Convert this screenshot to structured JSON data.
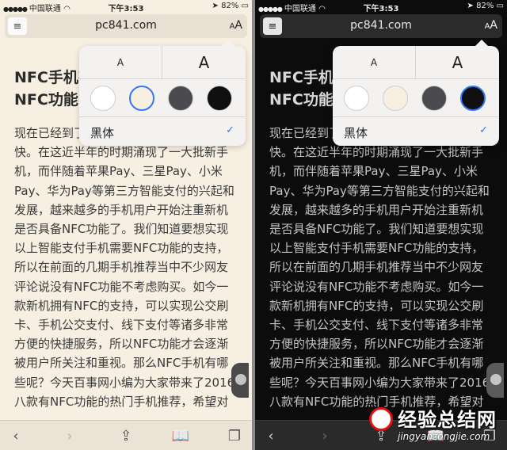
{
  "status": {
    "carrier": "中国联通",
    "time": "下午3:53",
    "battery": "82%"
  },
  "addressbar": {
    "url": "pc841.com",
    "aa_small": "A",
    "aa_large": "A"
  },
  "article": {
    "title_lines": [
      "NFC手机有哪些",
      "NFC功能的热门手机"
    ],
    "paragraph_lines": [
      "现在已经到了双十一的时候，时间过得真",
      "快。在这近半年的时期涌现了一大批新手",
      "机，而伴随着苹果Pay、三星Pay、小米",
      "Pay、华为Pay等第三方智能支付的兴起和",
      "发展，越来越多的手机用户开始注重新机",
      "是否具备NFC功能了。我们知道要想实现",
      "以上智能支付手机需要NFC功能的支持，",
      "所以在前面的几期手机推荐当中不少网友",
      "评论说没有NFC功能不考虑购买。如今一",
      "款新机拥有NFC的支持，可以实现公交刷",
      "卡、手机公交支付、线下支付等诸多非常",
      "方便的快捷服务，所以NFC功能才会逐渐",
      "被用户所关注和重视。那么NFC手机有哪",
      "些呢？今天百事网小编为大家带来了2016",
      "八款有NFC功能的热门手机推荐，希望对"
    ]
  },
  "popover": {
    "size_small": "A",
    "size_large": "A",
    "font_name": "黑体",
    "checkmark": "✓",
    "themes": [
      {
        "name": "white",
        "color": "#ffffff"
      },
      {
        "name": "sepia",
        "color": "#f8efe0"
      },
      {
        "name": "gray",
        "color": "#4a4a4f"
      },
      {
        "name": "black",
        "color": "#101010"
      }
    ],
    "selected_left": "sepia",
    "selected_right": "black"
  },
  "toolbar": {
    "back_icon": "‹",
    "forward_icon": "›",
    "share_icon": "⇪",
    "bookmarks_icon": "📖",
    "tabs_icon": "❐"
  },
  "watermark": {
    "text": "经验总结网",
    "url": "jingyanzongjie.com"
  },
  "colors": {
    "sepia_bg": "#f7efe1",
    "dark_bg": "#0c0c0c",
    "accent": "#3478f6"
  }
}
